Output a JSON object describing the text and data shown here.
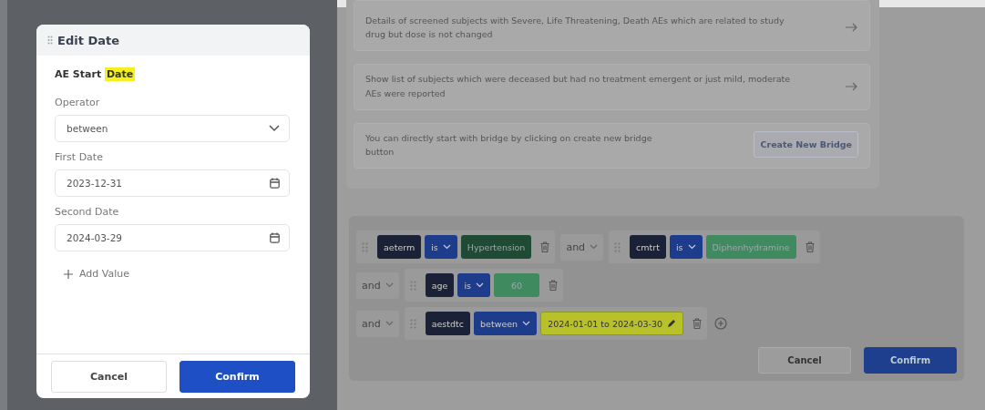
{
  "background": {
    "suggestions": [
      {
        "text": "Details of screened subjects with Severe, Life Threatening, Death AEs which are related to study drug but dose is not changed",
        "kind": "arrow"
      },
      {
        "text": "Show list of subjects which were deceased but had no treatment emergent or just mild, moderate AEs were reported",
        "kind": "arrow"
      },
      {
        "text": "You can directly start with bridge by clicking on create new bridge button",
        "kind": "button",
        "button": "Create New Bridge"
      }
    ],
    "query_builder": {
      "lines": [
        {
          "clauses": [
            {
              "kind": "condition",
              "field": "aeterm",
              "operator": "is",
              "value": "Hypertension",
              "color": "#1f4a33",
              "highlighted": false
            },
            {
              "kind": "connector",
              "label": "and"
            },
            {
              "kind": "condition",
              "field": "cmtrt",
              "operator": "is",
              "value": "Diphenhydramine",
              "color": "#3f8a5e",
              "highlighted": false
            }
          ]
        },
        {
          "clauses": [
            {
              "kind": "connector",
              "label": "and"
            },
            {
              "kind": "condition",
              "field": "age",
              "operator": "is",
              "value": "60",
              "color": "#3f8a5e",
              "highlighted": false
            }
          ]
        },
        {
          "clauses": [
            {
              "kind": "connector",
              "label": "and"
            },
            {
              "kind": "condition",
              "field": "aestdtc",
              "operator": "between",
              "value": "2024-01-01 to 2024-03-30",
              "color": "#b9c12a",
              "highlighted": true
            },
            {
              "kind": "add"
            }
          ]
        }
      ],
      "buttons": [
        {
          "label": "Cancel",
          "primary": false
        },
        {
          "label": "Confirm",
          "primary": true
        }
      ]
    }
  },
  "dialog": {
    "title": "Edit Date",
    "subtitle": "AE Start **Date**",
    "fields": [
      {
        "kind": "select",
        "label": "Operator",
        "value": "between"
      },
      {
        "kind": "date",
        "label": "First Date",
        "value": "2023-12-31"
      },
      {
        "kind": "date",
        "label": "Second Date",
        "value": "2024-03-29"
      }
    ],
    "add_value": "Add Value",
    "buttons": [
      {
        "label": "Cancel",
        "primary": false
      },
      {
        "label": "Confirm",
        "primary": true
      }
    ]
  }
}
